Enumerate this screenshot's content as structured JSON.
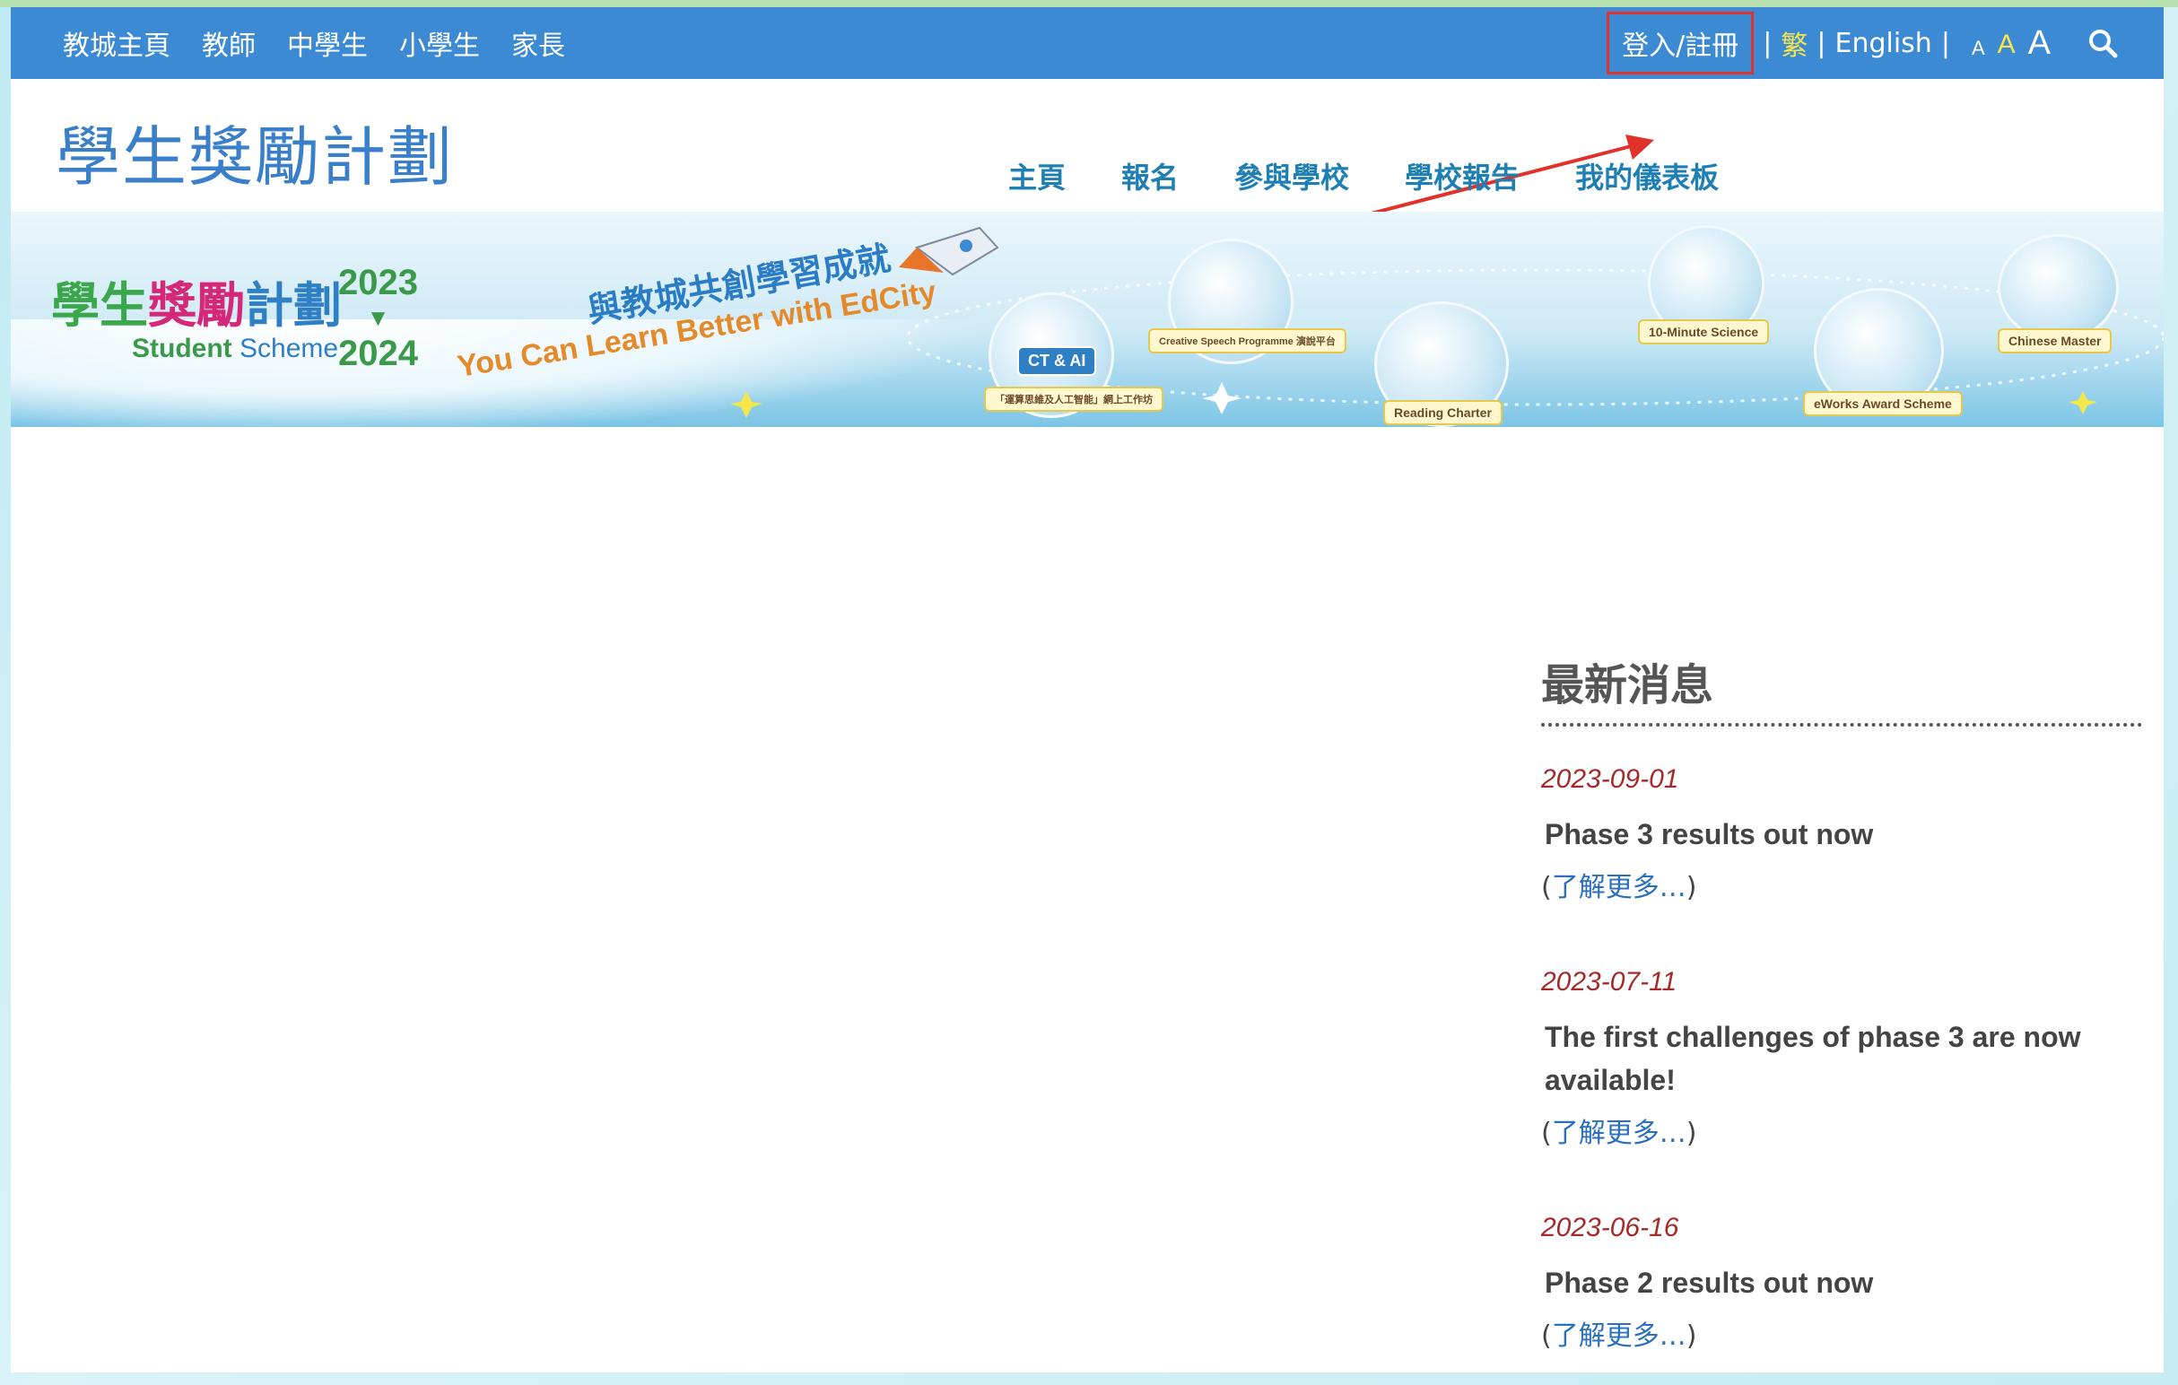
{
  "topbar": {
    "nav": [
      "教城主頁",
      "教師",
      "中學生",
      "小學生",
      "家長"
    ],
    "login_label": "登入/註冊",
    "separator": "|",
    "lang_trad": "繁",
    "lang_en": "English",
    "font_sizes": [
      "A",
      "A",
      "A"
    ],
    "colors": {
      "bar": "#3c8ad3",
      "highlight": "#f5e64a",
      "annotation": "#e0322a"
    }
  },
  "header": {
    "site_title": "學生獎勵計劃",
    "main_nav": [
      "主頁",
      "報名",
      "參與學校",
      "學校報告",
      "我的儀表板"
    ]
  },
  "banner": {
    "title_cn_parts": [
      "學生",
      "獎勵",
      "計劃"
    ],
    "scheme_parts": [
      "Student",
      "Scheme"
    ],
    "year_start": "2023",
    "year_arrow": "▼",
    "year_end": "2024",
    "slogan_cn": "與教城共創學習成就",
    "slogan_en": "You Can Learn Better with EdCity",
    "programmes": [
      "CT & AI",
      "「運算思維及人工智能」網上工作坊",
      "Creative Speech Programme 演說平台",
      "Reading Charter",
      "10-Minute Science",
      "eWorks Award Scheme",
      "Chinese Master"
    ]
  },
  "news": {
    "heading": "最新消息",
    "items": [
      {
        "date": "2023-09-01",
        "headline": "Phase 3 results out now",
        "more_open": "(",
        "more": "了解更多…",
        "more_close": ")"
      },
      {
        "date": "2023-07-11",
        "headline": "The first challenges of phase 3 are now available!",
        "more_open": "(",
        "more": "了解更多…",
        "more_close": ")"
      },
      {
        "date": "2023-06-16",
        "headline": "Phase 2 results out now",
        "more_open": "(",
        "more": "了解更多…",
        "more_close": ")"
      }
    ]
  }
}
